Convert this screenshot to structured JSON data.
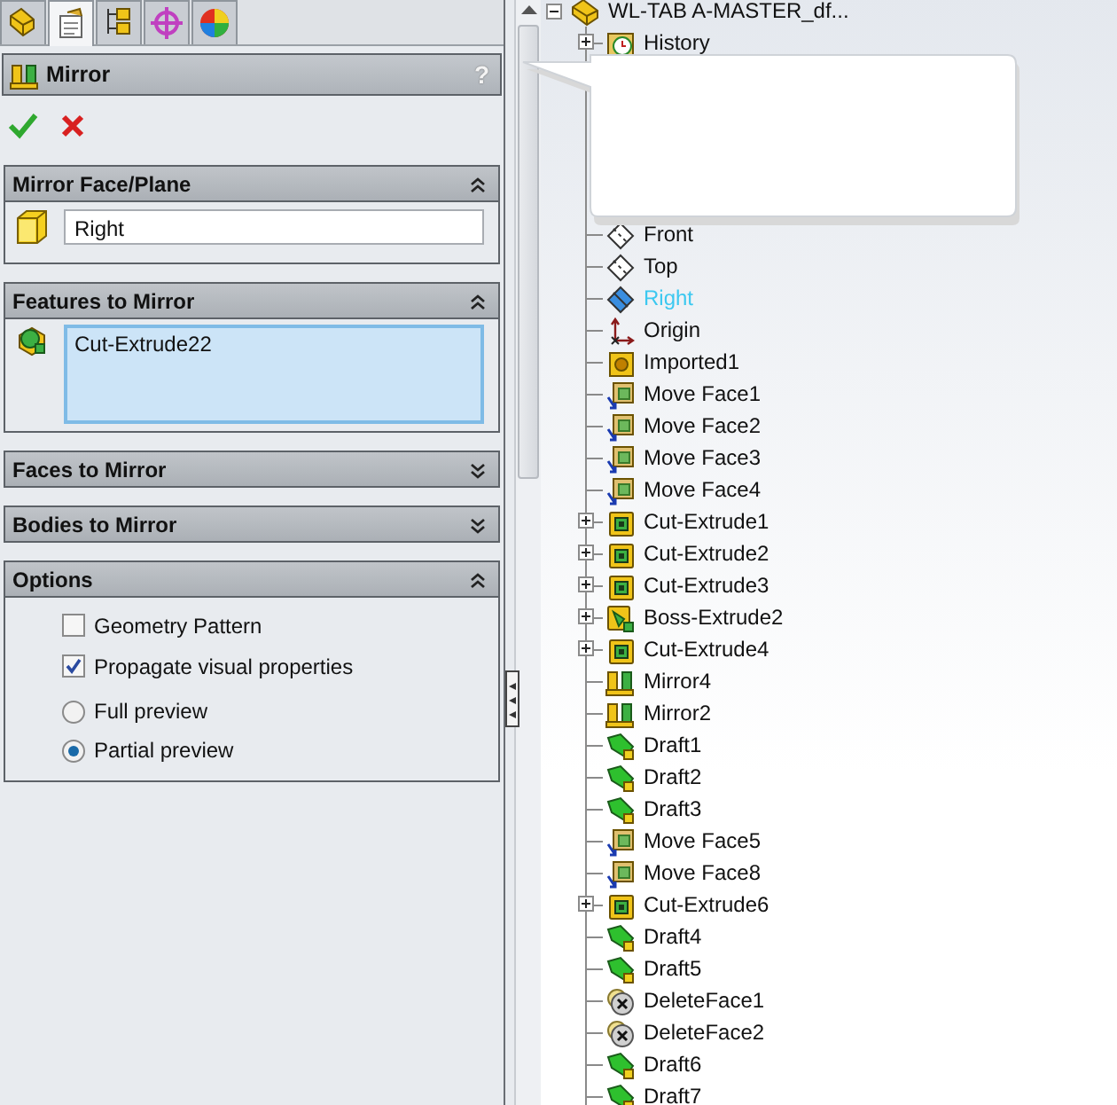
{
  "tabs": [
    {
      "kind": "feature-tree",
      "selected": false
    },
    {
      "kind": "property-manager",
      "selected": true
    },
    {
      "kind": "configuration",
      "selected": false
    },
    {
      "kind": "target",
      "selected": false
    },
    {
      "kind": "appearance",
      "selected": false
    }
  ],
  "property_manager": {
    "title": "Mirror",
    "help": "?",
    "groups": [
      {
        "kind": "field",
        "title": "Mirror Face/Plane",
        "expanded": true,
        "value": "Right"
      },
      {
        "kind": "list",
        "title": "Features to Mirror",
        "expanded": true,
        "items": [
          "Cut-Extrude22"
        ]
      },
      {
        "title": "Faces to Mirror",
        "expanded": false
      },
      {
        "title": "Bodies to Mirror",
        "expanded": false
      },
      {
        "kind": "options",
        "title": "Options",
        "expanded": true,
        "options": [
          {
            "kind": "checkbox",
            "label": "Geometry Pattern",
            "checked": false
          },
          {
            "kind": "checkbox",
            "label": "Propagate visual properties",
            "checked": true
          },
          {
            "kind": "radio",
            "label": "Full preview",
            "selected": false
          },
          {
            "kind": "radio",
            "label": "Partial preview",
            "selected": true
          }
        ]
      }
    ]
  },
  "tree": {
    "label": "WL-TAB A-MASTER_df...",
    "expanded": true,
    "children": [
      {
        "kind": "history",
        "label": "History",
        "expandable": true,
        "expanded": false,
        "selected": false
      },
      {
        "kind": "hidden"
      },
      {
        "kind": "plane",
        "label": "Front",
        "expandable": false,
        "selected": false
      },
      {
        "kind": "plane",
        "label": "Top",
        "expandable": false,
        "selected": false
      },
      {
        "kind": "plane",
        "label": "Right",
        "expandable": false,
        "selected": true
      },
      {
        "kind": "origin",
        "label": "Origin",
        "expandable": false,
        "selected": false
      },
      {
        "kind": "imported",
        "label": "Imported1",
        "expandable": false,
        "selected": false
      },
      {
        "kind": "move-face",
        "label": "Move Face1",
        "expandable": false,
        "selected": false
      },
      {
        "kind": "move-face",
        "label": "Move Face2",
        "expandable": false,
        "selected": false
      },
      {
        "kind": "move-face",
        "label": "Move Face3",
        "expandable": false,
        "selected": false
      },
      {
        "kind": "move-face",
        "label": "Move Face4",
        "expandable": false,
        "selected": false
      },
      {
        "kind": "cut-extrude",
        "label": "Cut-Extrude1",
        "expandable": true,
        "expanded": false,
        "selected": false
      },
      {
        "kind": "cut-extrude",
        "label": "Cut-Extrude2",
        "expandable": true,
        "expanded": false,
        "selected": false
      },
      {
        "kind": "cut-extrude",
        "label": "Cut-Extrude3",
        "expandable": true,
        "expanded": false,
        "selected": false
      },
      {
        "kind": "boss-extrude",
        "label": "Boss-Extrude2",
        "expandable": true,
        "expanded": false,
        "selected": false
      },
      {
        "kind": "cut-extrude",
        "label": "Cut-Extrude4",
        "expandable": true,
        "expanded": false,
        "selected": false
      },
      {
        "kind": "mirror",
        "label": "Mirror4",
        "expandable": false,
        "selected": false
      },
      {
        "kind": "mirror",
        "label": "Mirror2",
        "expandable": false,
        "selected": false
      },
      {
        "kind": "draft",
        "label": "Draft1",
        "expandable": false,
        "selected": false
      },
      {
        "kind": "draft",
        "label": "Draft2",
        "expandable": false,
        "selected": false
      },
      {
        "kind": "draft",
        "label": "Draft3",
        "expandable": false,
        "selected": false
      },
      {
        "kind": "move-face",
        "label": "Move Face5",
        "expandable": false,
        "selected": false
      },
      {
        "kind": "move-face",
        "label": "Move Face8",
        "expandable": false,
        "selected": false
      },
      {
        "kind": "cut-extrude",
        "label": "Cut-Extrude6",
        "expandable": true,
        "expanded": false,
        "selected": false
      },
      {
        "kind": "draft",
        "label": "Draft4",
        "expandable": false,
        "selected": false
      },
      {
        "kind": "draft",
        "label": "Draft5",
        "expandable": false,
        "selected": false
      },
      {
        "kind": "delete-face",
        "label": "DeleteFace1",
        "expandable": false,
        "selected": false
      },
      {
        "kind": "delete-face",
        "label": "DeleteFace2",
        "expandable": false,
        "selected": false
      },
      {
        "kind": "draft",
        "label": "Draft6",
        "expandable": false,
        "selected": false
      },
      {
        "kind": "draft",
        "label": "Draft7",
        "expandable": false,
        "selected": false
      }
    ]
  }
}
